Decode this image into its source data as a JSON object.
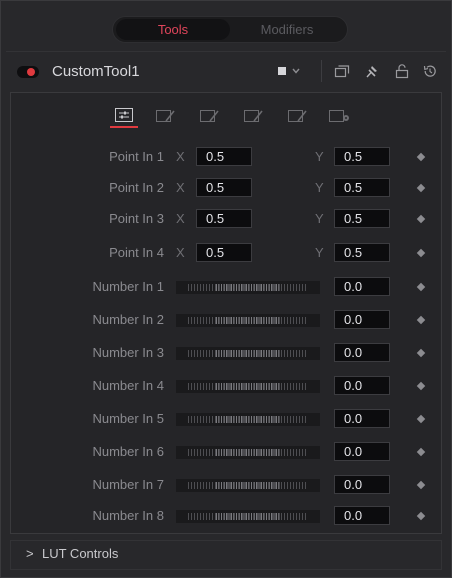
{
  "tabs": {
    "tools": "Tools",
    "modifiers": "Modifiers"
  },
  "header": {
    "tool_name": "CustomTool1"
  },
  "icon_tabs": [
    "controls-tab",
    "edit-tab-1",
    "edit-tab-2",
    "edit-tab-3",
    "edit-tab-4",
    "settings-tab"
  ],
  "points": [
    {
      "label": "Point In 1",
      "x_axis": "X",
      "x": "0.5",
      "y_axis": "Y",
      "y": "0.5"
    },
    {
      "label": "Point In 2",
      "x_axis": "X",
      "x": "0.5",
      "y_axis": "Y",
      "y": "0.5"
    },
    {
      "label": "Point In 3",
      "x_axis": "X",
      "x": "0.5",
      "y_axis": "Y",
      "y": "0.5"
    },
    {
      "label": "Point In 4",
      "x_axis": "X",
      "x": "0.5",
      "y_axis": "Y",
      "y": "0.5"
    }
  ],
  "numbers": [
    {
      "label": "Number In 1",
      "value": "0.0"
    },
    {
      "label": "Number In 2",
      "value": "0.0"
    },
    {
      "label": "Number In 3",
      "value": "0.0"
    },
    {
      "label": "Number In 4",
      "value": "0.0"
    },
    {
      "label": "Number In 5",
      "value": "0.0"
    },
    {
      "label": "Number In 6",
      "value": "0.0"
    },
    {
      "label": "Number In 7",
      "value": "0.0"
    },
    {
      "label": "Number In 8",
      "value": "0.0"
    }
  ],
  "lut": {
    "chevron": ">",
    "label": "LUT Controls"
  },
  "colors": {
    "accent": "#e03a3f",
    "tab_active_text": "#e0455b"
  }
}
